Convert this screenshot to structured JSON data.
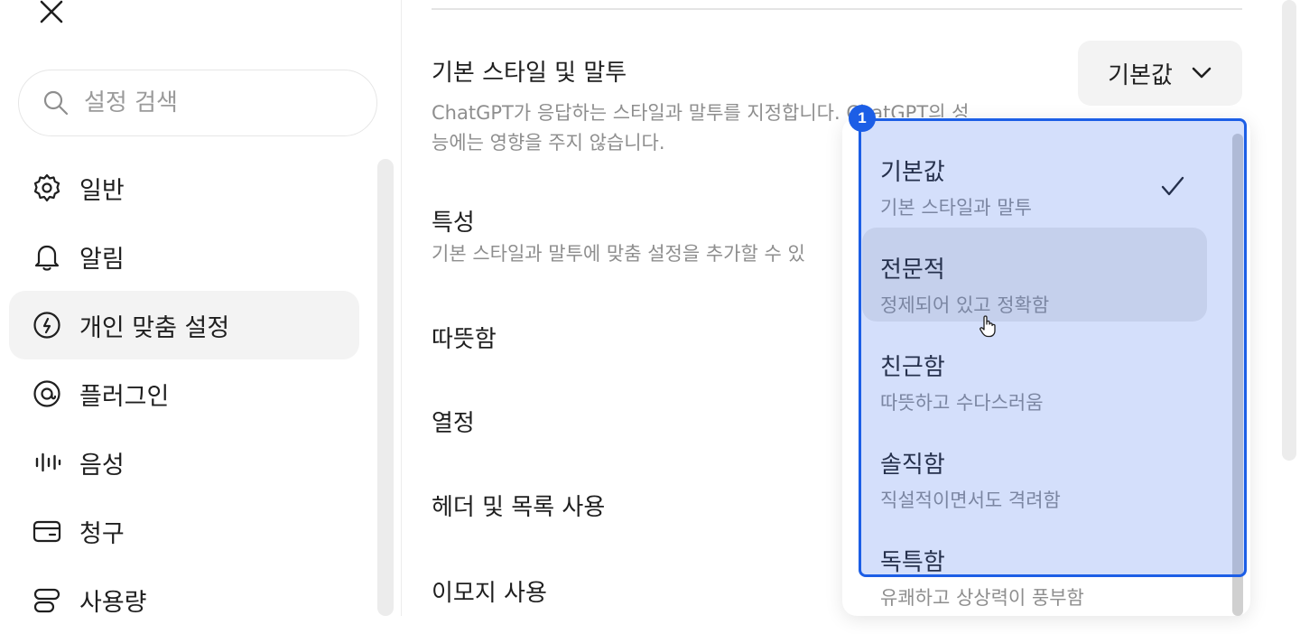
{
  "sidebar": {
    "search_placeholder": "설정 검색",
    "items": [
      {
        "label": "일반",
        "icon": "gear-icon"
      },
      {
        "label": "알림",
        "icon": "bell-icon"
      },
      {
        "label": "개인 맞춤 설정",
        "icon": "personalization-icon",
        "active": true
      },
      {
        "label": "플러그인",
        "icon": "plugin-icon"
      },
      {
        "label": "음성",
        "icon": "voice-wave-icon"
      },
      {
        "label": "청구",
        "icon": "card-icon"
      },
      {
        "label": "사용량",
        "icon": "usage-icon"
      }
    ]
  },
  "main": {
    "style_title": "기본 스타일 및 말투",
    "style_desc_line1": "ChatGPT가 응답하는 스타일과 말투를 지정합니다. ChatGPT의 성",
    "style_desc_line2": "능에는 영향을 주지 않습니다.",
    "style_select_value": "기본값",
    "traits_title": "특성",
    "traits_desc": "기본 스타일과 말투에 맞춤 설정을 추가할 수 있",
    "rows": [
      "따뜻함",
      "열정",
      "헤더 및 목록 사용",
      "이모지 사용"
    ]
  },
  "menu": {
    "options": [
      {
        "title": "기본값",
        "subtitle": "기본 스타일과 말투",
        "selected": true
      },
      {
        "title": "전문적",
        "subtitle": "정제되어 있고 정확함",
        "hovered": true
      },
      {
        "title": "친근함",
        "subtitle": "따뜻하고 수다스러움"
      },
      {
        "title": "솔직함",
        "subtitle": "직설적이면서도 격려함"
      },
      {
        "title": "독특함",
        "subtitle": "유쾌하고 상상력이 풍부함"
      }
    ]
  },
  "annotation": {
    "marker": "1",
    "color": "#1c5ee6"
  },
  "colors": {
    "highlight": "#1c5ee6",
    "muted_text": "#8e8e8e",
    "active_bg": "#f3f3f3"
  }
}
